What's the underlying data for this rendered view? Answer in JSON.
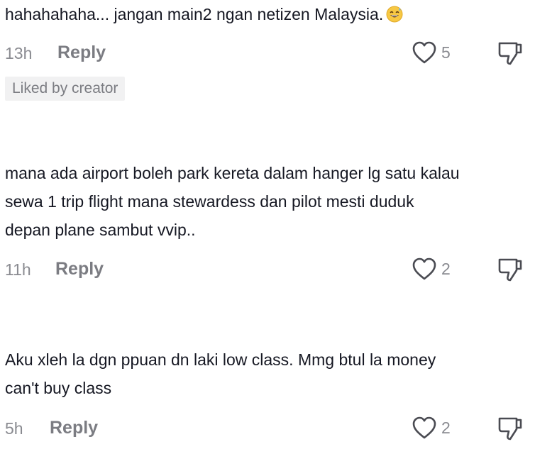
{
  "comments": [
    {
      "text": "hahahahaha... jangan main2 ngan netizen Malaysia.",
      "emoji": "grinning-sweat-emoji",
      "time": "13h",
      "reply_label": "Reply",
      "likes": "5",
      "badge": "Liked by creator"
    },
    {
      "lines": [
        "mana ada airport boleh park kereta dalam hanger lg satu kalau",
        "sewa 1 trip flight mana stewardess dan pilot mesti duduk",
        "depan plane sambut vvip.."
      ],
      "time": "11h",
      "reply_label": "Reply",
      "likes": "2"
    },
    {
      "lines": [
        "Aku xleh la dgn ppuan dn laki low class. Mmg btul la money",
        "can't buy class"
      ],
      "time": "5h",
      "reply_label": "Reply",
      "likes": "2"
    }
  ],
  "icons": {
    "like": "heart-outline-icon",
    "dislike": "thumbs-down-outline-icon"
  },
  "colors": {
    "text": "#161823",
    "muted": "#8a8b91",
    "reply": "#7b7c82",
    "badge_bg": "#f1f1f2"
  }
}
